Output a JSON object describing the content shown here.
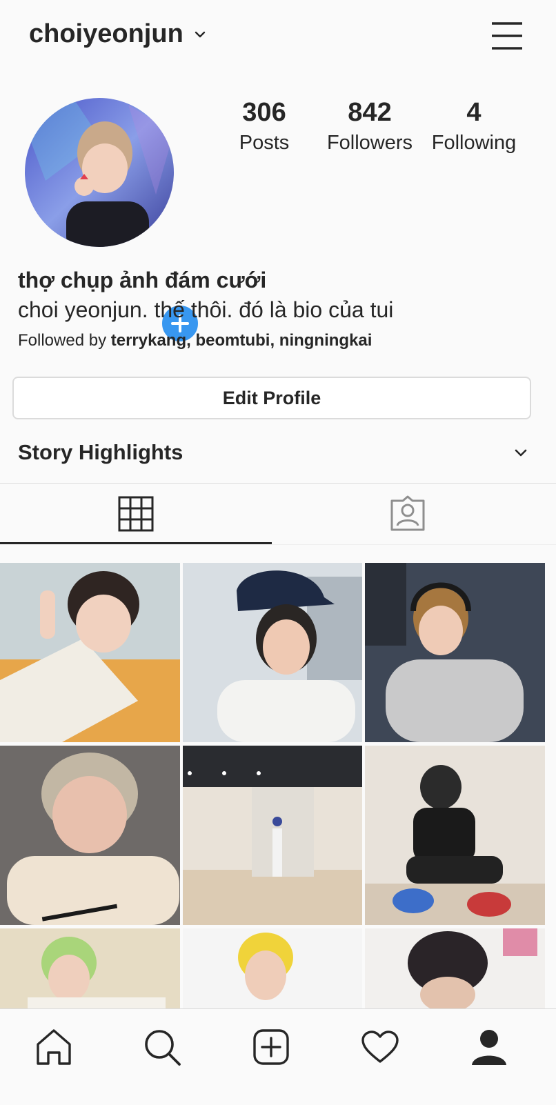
{
  "header": {
    "username": "choiyeonjun",
    "username_chevron_icon": "chevron-down-icon",
    "menu_icon": "hamburger-menu-icon"
  },
  "profile": {
    "avatar_alt": "profile-photo",
    "add_story_icon": "plus-icon",
    "stats": [
      {
        "value": "306",
        "label": "Posts"
      },
      {
        "value": "842",
        "label": "Followers"
      },
      {
        "value": "4",
        "label": "Following"
      }
    ],
    "display_name": "thợ chụp ảnh đám cưới",
    "bio": "choi yeonjun. thế thôi. đó là bio của tui",
    "followed_by_prefix": "Followed by ",
    "followed_by_names": "terrykang, beomtubi, ningningkai"
  },
  "actions": {
    "edit_profile_label": "Edit Profile"
  },
  "highlights": {
    "title": "Story Highlights",
    "expand_icon": "chevron-down-icon"
  },
  "tabs": [
    {
      "name": "posts-grid",
      "icon": "grid-icon",
      "active": true
    },
    {
      "name": "tagged",
      "icon": "tagged-person-icon",
      "active": false
    }
  ],
  "grid_posts": [
    {
      "id": 1,
      "desc": "photo-peace-sign-yellow-cardigan"
    },
    {
      "id": 2,
      "desc": "photo-navy-cap-white-shirt"
    },
    {
      "id": 3,
      "desc": "photo-headphones-grey-hoodie"
    },
    {
      "id": 4,
      "desc": "photo-beige-sweater-pen"
    },
    {
      "id": 5,
      "desc": "photo-dance-practice-room"
    },
    {
      "id": 6,
      "desc": "photo-sitting-colorful-sneakers"
    },
    {
      "id": 7,
      "desc": "photo-green-hair-outdoor"
    },
    {
      "id": 8,
      "desc": "photo-yellow-hair-white-bg"
    },
    {
      "id": 9,
      "desc": "photo-black-beanie"
    }
  ],
  "bottom_nav": [
    {
      "name": "home",
      "icon": "home-icon"
    },
    {
      "name": "search",
      "icon": "search-icon"
    },
    {
      "name": "new-post",
      "icon": "add-post-icon"
    },
    {
      "name": "activity",
      "icon": "heart-icon"
    },
    {
      "name": "profile",
      "icon": "profile-icon",
      "active": true
    }
  ],
  "colors": {
    "background": "#fafafa",
    "text": "#262626",
    "accent_blue": "#3897f0",
    "border": "#dbdbdb"
  }
}
